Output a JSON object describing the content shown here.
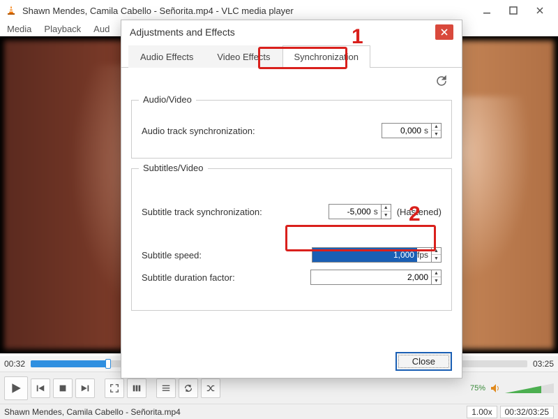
{
  "window": {
    "title": "Shawn Mendes, Camila Cabello - Señorita.mp4 - VLC media player"
  },
  "menubar": [
    "Media",
    "Playback",
    "Aud"
  ],
  "time": {
    "current": "00:32",
    "total": "03:25"
  },
  "status": {
    "filename": "Shawn Mendes, Camila Cabello - Señorita.mp4",
    "speed": "1.00x",
    "time": "00:32/03:25"
  },
  "volume": {
    "percent": "75%"
  },
  "dialog": {
    "title": "Adjustments and Effects",
    "tabs": [
      "Audio Effects",
      "Video Effects",
      "Synchronization"
    ],
    "active_tab": 2,
    "group1": {
      "legend": "Audio/Video",
      "audio_sync_label": "Audio track synchronization:",
      "audio_sync_value": "0,000",
      "audio_sync_unit": "s"
    },
    "group2": {
      "legend": "Subtitles/Video",
      "sub_sync_label": "Subtitle track synchronization:",
      "sub_sync_value": "-5,000",
      "sub_sync_unit": "s",
      "sub_sync_note": "(Hastened)",
      "sub_speed_label": "Subtitle speed:",
      "sub_speed_value": "1,000",
      "sub_speed_unit": "fps",
      "sub_dur_label": "Subtitle duration factor:",
      "sub_dur_value": "2,000"
    },
    "close": "Close"
  },
  "annotations": {
    "n1": "1",
    "n2": "2"
  }
}
